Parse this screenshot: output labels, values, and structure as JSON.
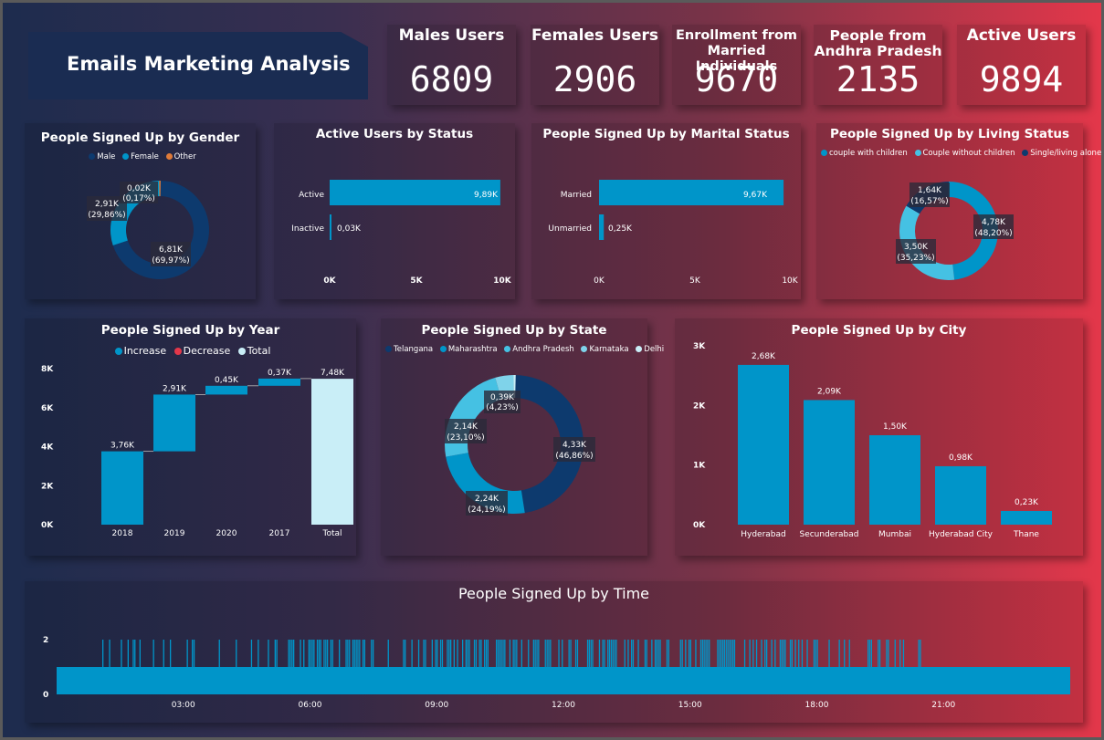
{
  "dashboard_title": "Emails Marketing Analysis",
  "colors": {
    "dark_navy": "#0d3a6e",
    "teal": "#0095c9",
    "light_teal": "#45c1e3",
    "orange": "#e07b39",
    "pale": "#c9eef7",
    "red": "#e3374a"
  },
  "kpis": [
    {
      "label": "Males Users",
      "value": "6809"
    },
    {
      "label": "Females Users",
      "value": "2906"
    },
    {
      "label": "Enrollment from Married Individuals",
      "value": "9670"
    },
    {
      "label": "People from Andhra Pradesh",
      "value": "2135"
    },
    {
      "label": "Active Users",
      "value": "9894"
    }
  ],
  "gender_chart": {
    "title": "People Signed Up by Gender",
    "legend": [
      "Male",
      "Female",
      "Other"
    ],
    "labels": [
      {
        "value": "6,81K",
        "pct": "(69,97%)"
      },
      {
        "value": "2,91K",
        "pct": "(29,86%)"
      },
      {
        "value": "0,02K",
        "pct": "(0,17%)"
      }
    ]
  },
  "status_chart": {
    "title": "Active Users by Status",
    "categories": [
      "Active",
      "Inactive"
    ],
    "value_labels": [
      "9,89K",
      "0,03K"
    ],
    "ticks": [
      "0K",
      "5K",
      "10K"
    ]
  },
  "marital_chart": {
    "title": "People Signed Up by Marital Status",
    "categories": [
      "Married",
      "Unmarried"
    ],
    "value_labels": [
      "9,67K",
      "0,25K"
    ],
    "ticks": [
      "0K",
      "5K",
      "10K"
    ]
  },
  "living_chart": {
    "title": "People Signed Up by Living Status",
    "legend": [
      "couple with children",
      "Couple without children",
      "Single/living alone"
    ],
    "labels": [
      {
        "value": "4,78K",
        "pct": "(48,20%)"
      },
      {
        "value": "3,50K",
        "pct": "(35,23%)"
      },
      {
        "value": "1,64K",
        "pct": "(16,57%)"
      }
    ]
  },
  "year_chart": {
    "title": "People Signed Up by Year",
    "legend": [
      "Increase",
      "Decrease",
      "Total"
    ],
    "categories": [
      "2018",
      "2019",
      "2020",
      "2017",
      "Total"
    ],
    "value_labels": [
      "3,76K",
      "2,91K",
      "0,45K",
      "0,37K",
      "7,48K"
    ],
    "y_ticks": [
      "0K",
      "2K",
      "4K",
      "6K",
      "8K"
    ]
  },
  "state_chart": {
    "title": "People Signed Up by State",
    "legend": [
      "Telangana",
      "Maharashtra",
      "Andhra Pradesh",
      "Karnataka",
      "Delhi"
    ],
    "labels": [
      {
        "value": "4,33K",
        "pct": "(46,86%)"
      },
      {
        "value": "2,24K",
        "pct": "(24,19%)"
      },
      {
        "value": "2,14K",
        "pct": "(23,10%)"
      },
      {
        "value": "0,39K",
        "pct": "(4,23%)"
      }
    ]
  },
  "city_chart": {
    "title": "People Signed Up by City",
    "categories": [
      "Hyderabad",
      "Secunderabad",
      "Mumbai",
      "Hyderabad City",
      "Thane"
    ],
    "value_labels": [
      "2,68K",
      "2,09K",
      "1,50K",
      "0,98K",
      "0,23K"
    ],
    "y_ticks": [
      "0K",
      "1K",
      "2K",
      "3K"
    ]
  },
  "time_chart": {
    "title": "People Signed Up by Time",
    "y_ticks": [
      "0",
      "2"
    ],
    "x_ticks": [
      "03:00",
      "06:00",
      "09:00",
      "12:00",
      "15:00",
      "18:00",
      "21:00"
    ]
  },
  "chart_data": [
    {
      "type": "pie",
      "title": "People Signed Up by Gender",
      "categories": [
        "Male",
        "Female",
        "Other"
      ],
      "values": [
        6.81,
        2.91,
        0.02
      ],
      "unit": "K"
    },
    {
      "type": "bar",
      "title": "Active Users by Status",
      "categories": [
        "Active",
        "Inactive"
      ],
      "values": [
        9.89,
        0.03
      ],
      "xlim": [
        0,
        10
      ],
      "unit": "K"
    },
    {
      "type": "bar",
      "title": "People Signed Up by Marital Status",
      "categories": [
        "Married",
        "Unmarried"
      ],
      "values": [
        9.67,
        0.25
      ],
      "xlim": [
        0,
        10
      ],
      "unit": "K"
    },
    {
      "type": "pie",
      "title": "People Signed Up by Living Status",
      "categories": [
        "couple with children",
        "Couple without children",
        "Single/living alone"
      ],
      "values": [
        4.78,
        3.5,
        1.64
      ],
      "unit": "K"
    },
    {
      "type": "bar",
      "title": "People Signed Up by Year",
      "categories": [
        "2018",
        "2019",
        "2020",
        "2017",
        "Total"
      ],
      "values": [
        3.76,
        2.91,
        0.45,
        0.37,
        7.48
      ],
      "ylim": [
        0,
        8
      ],
      "unit": "K"
    },
    {
      "type": "pie",
      "title": "People Signed Up by State",
      "categories": [
        "Telangana",
        "Maharashtra",
        "Andhra Pradesh",
        "Karnataka",
        "Delhi"
      ],
      "values": [
        4.33,
        2.24,
        2.14,
        0.39,
        0.01
      ],
      "unit": "K"
    },
    {
      "type": "bar",
      "title": "People Signed Up by City",
      "categories": [
        "Hyderabad",
        "Secunderabad",
        "Mumbai",
        "Hyderabad City",
        "Thane"
      ],
      "values": [
        2.68,
        2.09,
        1.5,
        0.98,
        0.23
      ],
      "ylim": [
        0,
        3
      ],
      "unit": "K"
    },
    {
      "type": "bar",
      "title": "People Signed Up by Time",
      "ylim": [
        0,
        2
      ]
    }
  ]
}
